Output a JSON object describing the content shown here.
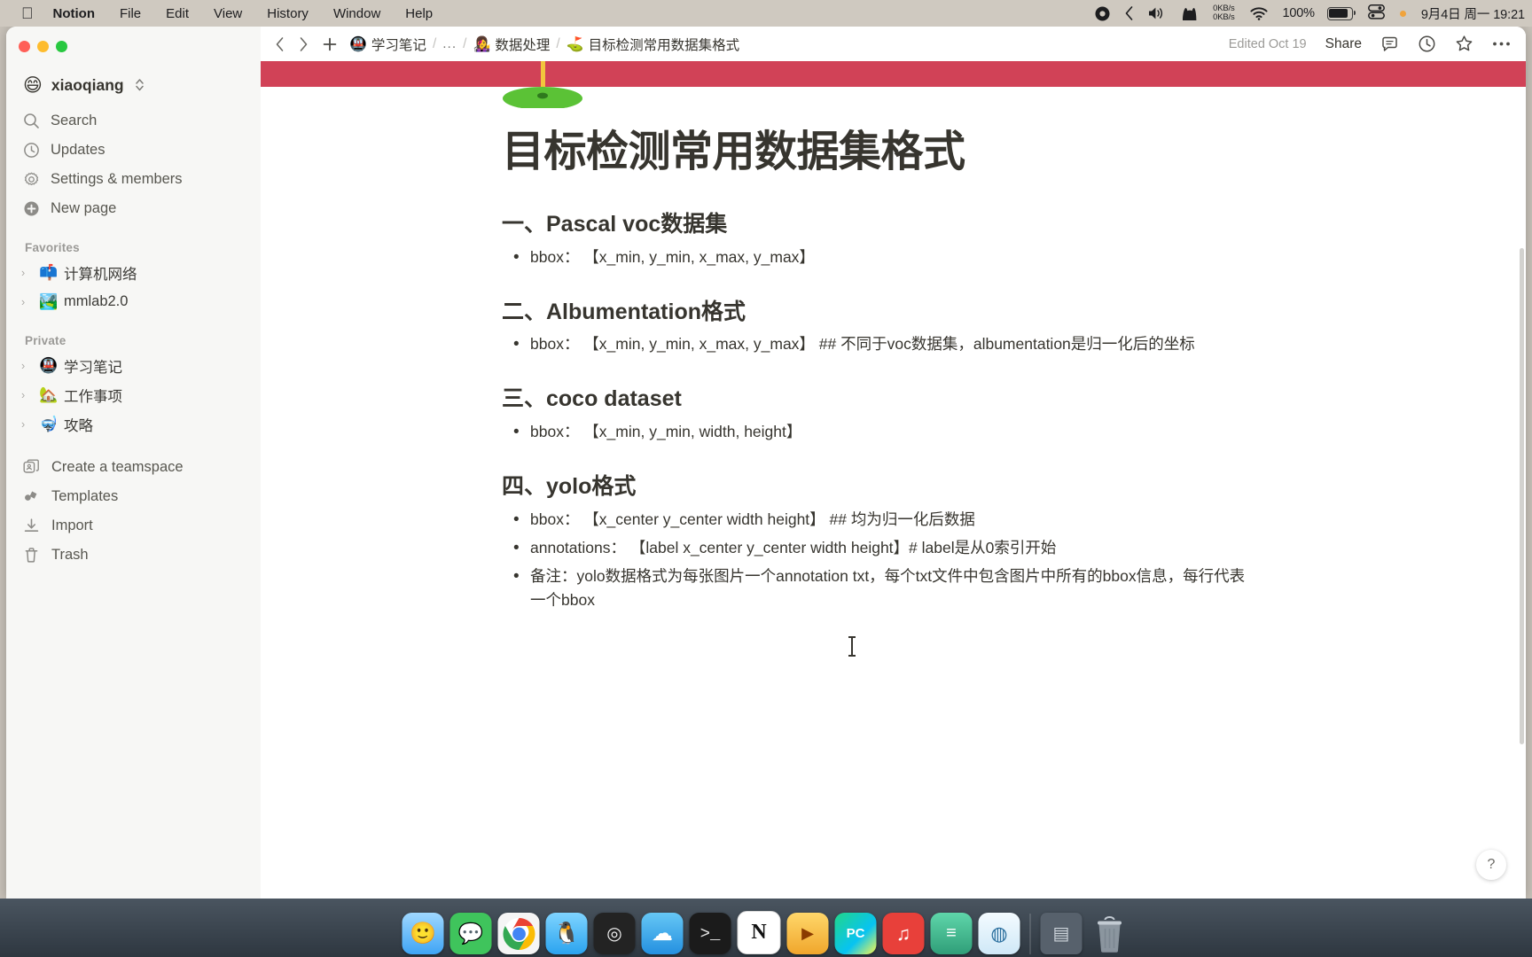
{
  "menubar": {
    "apple_icon": "apple-logo-icon",
    "items": [
      "Notion",
      "File",
      "Edit",
      "View",
      "History",
      "Window",
      "Help"
    ],
    "status": {
      "record_icon": "record-icon",
      "back_icon": "chevron-left-icon",
      "volume_icon": "volume-icon",
      "cat_icon": "cat-icon",
      "net_up": "0KB/s",
      "net_down": "0KB/s",
      "wifi_icon": "wifi-icon",
      "battery_percent": "100%",
      "battery_icon": "battery-icon",
      "control_center_icon": "control-center-icon",
      "siri_dot_icon": "status-dot-icon",
      "clock": "9月4日 周一  19:21"
    }
  },
  "window": {
    "traffic_lights": [
      "close",
      "minimize",
      "zoom"
    ]
  },
  "sidebar": {
    "workspace": {
      "emoji": "😄",
      "name": "xiaoqiang",
      "caret_icon": "chevron-updown-icon"
    },
    "nav": [
      {
        "icon": "search-icon",
        "label": "Search"
      },
      {
        "icon": "clock-icon",
        "label": "Updates"
      },
      {
        "icon": "gear-icon",
        "label": "Settings & members"
      },
      {
        "icon": "plus-circle-icon",
        "label": "New page"
      }
    ],
    "favorites_title": "Favorites",
    "favorites": [
      {
        "emoji": "📫",
        "label": "计算机网络"
      },
      {
        "emoji": "🏞️",
        "label": "mmlab2.0"
      }
    ],
    "private_title": "Private",
    "private": [
      {
        "emoji": "🚇",
        "label": "学习笔记"
      },
      {
        "emoji": "🏡",
        "label": "工作事项"
      },
      {
        "emoji": "🤿",
        "label": "攻略"
      }
    ],
    "bottom": [
      {
        "icon": "teamspace-icon",
        "label": "Create a teamspace"
      },
      {
        "icon": "templates-icon",
        "label": "Templates"
      },
      {
        "icon": "import-icon",
        "label": "Import"
      },
      {
        "icon": "trash-icon",
        "label": "Trash"
      }
    ]
  },
  "topbar": {
    "back_icon": "chevron-left-icon",
    "forward_icon": "chevron-right-icon",
    "new_icon": "plus-icon",
    "breadcrumb": [
      {
        "emoji": "🚇",
        "label": "学习笔记"
      },
      {
        "emoji": "",
        "label": "..."
      },
      {
        "emoji": "👩‍🎤",
        "label": "数据处理"
      },
      {
        "emoji": "⛳",
        "label": "目标检测常用数据集格式"
      }
    ],
    "separator": "/",
    "edited": "Edited Oct 19",
    "share": "Share",
    "comment_icon": "comment-icon",
    "history_icon": "history-clock-icon",
    "favorite_icon": "star-icon",
    "more_icon": "more-horizontal-icon"
  },
  "page": {
    "cover_color": "#d14257",
    "icon_emoji": "⛳",
    "title": "目标检测常用数据集格式",
    "sections": [
      {
        "heading": "一、Pascal voc数据集",
        "bullets": [
          "bbox： 【x_min, y_min, x_max, y_max】"
        ]
      },
      {
        "heading": "二、Albumentation格式",
        "bullets": [
          "bbox： 【x_min, y_min, x_max, y_max】 ## 不同于voc数据集，albumentation是归一化后的坐标"
        ]
      },
      {
        "heading": "三、coco dataset",
        "bullets": [
          "bbox： 【x_min, y_min, width, height】"
        ]
      },
      {
        "heading": "四、yolo格式",
        "bullets": [
          "bbox： 【x_center y_center width height】  ## 均为归一化后数据",
          "annotations： 【label x_center y_center width height】# label是从0索引开始",
          "备注：yolo数据格式为每张图片一个annotation txt，每个txt文件中包含图片中所有的bbox信息，每行代表一个bbox"
        ]
      }
    ],
    "help_label": "?"
  },
  "dock": {
    "items": [
      {
        "name": "finder",
        "emoji": "🙂",
        "bg": "#3ea4f5",
        "running": true
      },
      {
        "name": "wechat",
        "emoji": "💬",
        "bg": "#3fc45c",
        "running": true
      },
      {
        "name": "chrome",
        "emoji": "◉",
        "bg": "#f5f5f5",
        "running": true
      },
      {
        "name": "qq",
        "emoji": "🐧",
        "bg": "#3fb2f5",
        "running": false
      },
      {
        "name": "screenshot-tool",
        "emoji": "◎",
        "bg": "#2b2b2b",
        "running": false
      },
      {
        "name": "cloud-drive",
        "emoji": "☁",
        "bg": "#2fa8e8",
        "running": false
      },
      {
        "name": "terminal",
        "emoji": "❯",
        "bg": "#1c1c1c",
        "running": true
      },
      {
        "name": "notion",
        "emoji": "N",
        "bg": "#ffffff",
        "running": true
      },
      {
        "name": "translate",
        "emoji": "▶",
        "bg": "#f5b33c",
        "running": false
      },
      {
        "name": "pycharm",
        "emoji": "PC",
        "bg": "#22d37b",
        "running": true
      },
      {
        "name": "netease-music",
        "emoji": "♪",
        "bg": "#e8403a",
        "running": false
      },
      {
        "name": "typora",
        "emoji": "≡",
        "bg": "#3fbf8f",
        "running": false
      },
      {
        "name": "preview",
        "emoji": "◍",
        "bg": "#e8f4fb",
        "running": false
      },
      {
        "name": "downloads-stack",
        "emoji": "▤",
        "bg": "#4c5662",
        "running": false
      },
      {
        "name": "trash",
        "emoji": "🗑",
        "bg": "#5c6670",
        "running": false
      }
    ]
  }
}
